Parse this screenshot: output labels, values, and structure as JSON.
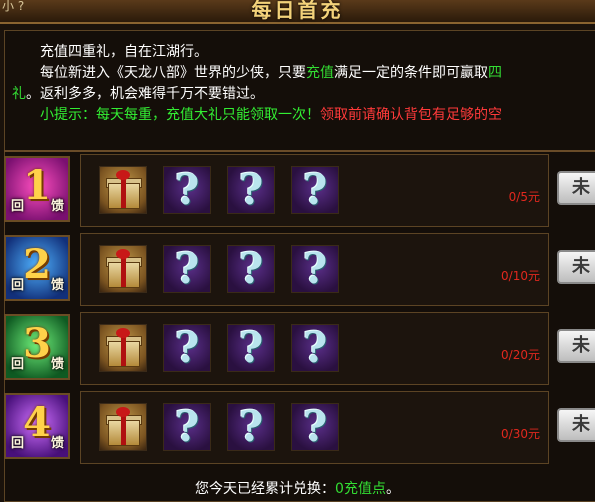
{
  "header": {
    "corner_text": "小 ?",
    "title": "每日首充"
  },
  "description": {
    "line1": "充值四重礼，自在江湖行。",
    "line2_a": "每位新进入《天龙八部》世界的少侠，只要",
    "line2_highlight": "充值",
    "line2_b": "满足一定的条件即可赢取",
    "line2_tail": "四",
    "line3_head": "礼",
    "line3": "。返利多多，机会难得千万不要错过。",
    "tip_label": "小提示：每天每重，充值大礼只能领取一次！",
    "tip_warning": "领取前请确认背包有足够的空"
  },
  "tiers": [
    {
      "hui": "回",
      "number": "1",
      "kui": "馈",
      "progress": "0/5元",
      "claim_label": "未",
      "color_a": "#ff4fc0",
      "color_b": "#7a1070"
    },
    {
      "hui": "回",
      "number": "2",
      "kui": "馈",
      "progress": "0/10元",
      "claim_label": "未",
      "color_a": "#4fb2ff",
      "color_b": "#12307a"
    },
    {
      "hui": "回",
      "number": "3",
      "kui": "馈",
      "progress": "0/20元",
      "claim_label": "未",
      "color_a": "#6ff07a",
      "color_b": "#0f5a22"
    },
    {
      "hui": "回",
      "number": "4",
      "kui": "馈",
      "progress": "0/30元",
      "claim_label": "未",
      "color_a": "#d070ff",
      "color_b": "#48107a"
    }
  ],
  "reward_items": [
    "gift-box-icon",
    "mystery-item-icon",
    "mystery-item-icon",
    "mystery-item-icon"
  ],
  "footer": {
    "prefix": "您今天已经累计兑换：",
    "amount": "0充值点",
    "suffix": "。"
  }
}
